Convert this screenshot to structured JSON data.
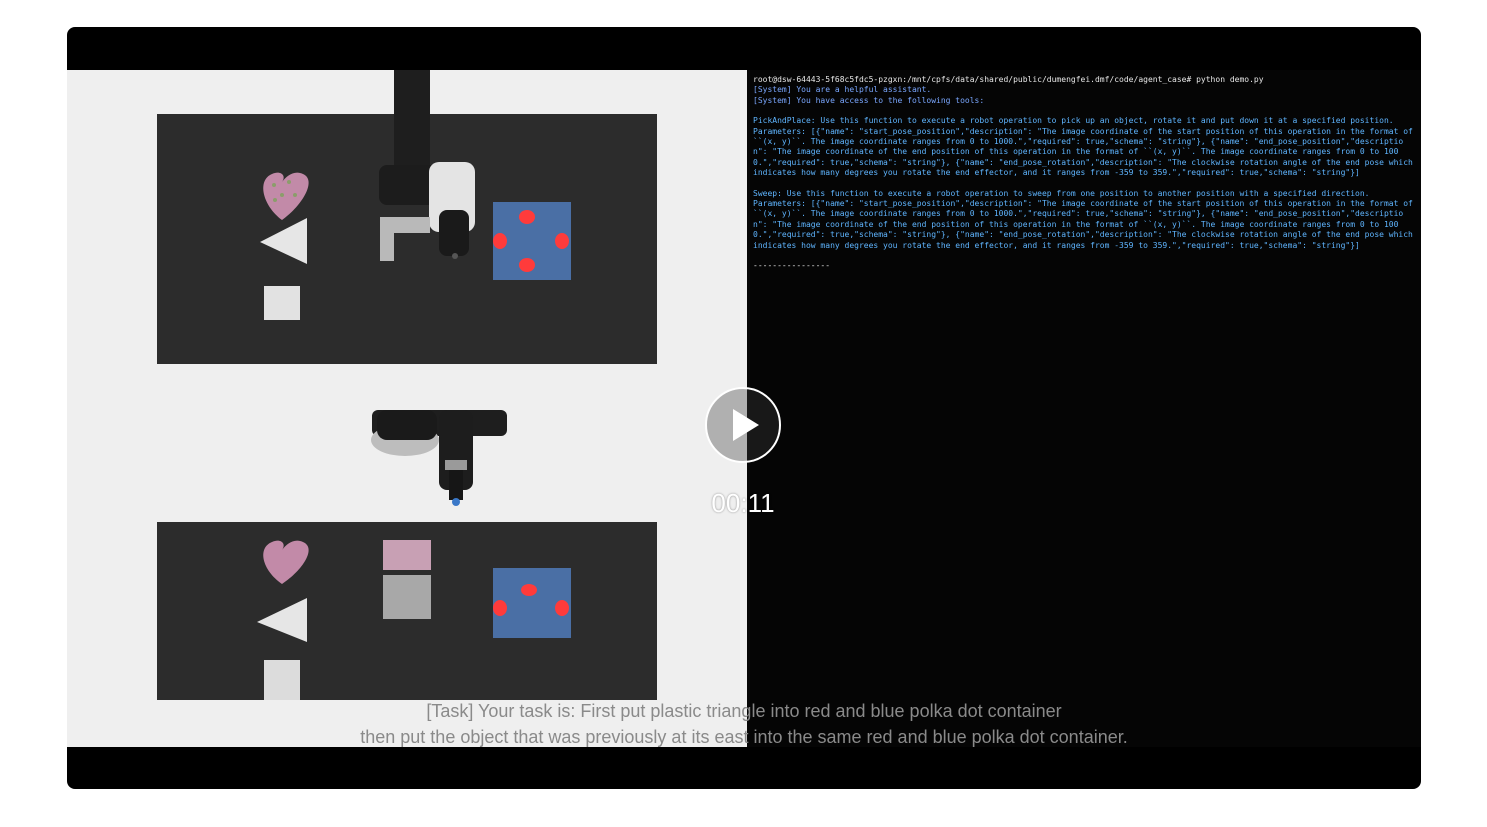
{
  "player": {
    "time": "00:11"
  },
  "terminal": {
    "lines": [
      {
        "text": "root@dsw-64443-5f68c5fdc5-pzgxn:/mnt/cpfs/data/shared/public/dumengfei.dmf/code/agent_case# python demo.py",
        "kind": "cmd"
      },
      {
        "text": "[System] You are a helpful assistant.",
        "kind": "sys"
      },
      {
        "text": "[System] You have access to the following tools:",
        "kind": "sys"
      },
      {
        "text": "",
        "kind": "blank"
      },
      {
        "text": "PickAndPlace: Use this function to execute a robot operation to pick up an object, rotate it and put down it at a specified position.",
        "kind": "tool"
      },
      {
        "text": "Parameters: [{\"name\": \"start_pose_position\",\"description\": \"The image coordinate of the start position of this operation in the format of ``(x, y)``. The image coordinate ranges from 0 to 1000.\",\"required\": true,\"schema\": \"string\"}, {\"name\": \"end_pose_position\",\"description\": \"The image coordinate of the end position of this operation in the format of ``(x, y)``. The image coordinate ranges from 0 to 1000.\",\"required\": true,\"schema\": \"string\"}, {\"name\": \"end_pose_rotation\",\"description\": \"The clockwise rotation angle of the end pose which indicates how many degrees you rotate the end effector, and it ranges from -359 to 359.\",\"required\": true,\"schema\": \"string\"}]",
        "kind": "params"
      },
      {
        "text": "",
        "kind": "blank"
      },
      {
        "text": "Sweep: Use this function to execute a robot operation to sweep from one position to another position with a specified direction.",
        "kind": "tool"
      },
      {
        "text": "Parameters: [{\"name\": \"start_pose_position\",\"description\": \"The image coordinate of the start position of this operation in the format of ``(x, y)``. The image coordinate ranges from 0 to 1000.\",\"required\": true,\"schema\": \"string\"}, {\"name\": \"end_pose_position\",\"description\": \"The image coordinate of the end position of this operation in the format of ``(x, y)``. The image coordinate ranges from 0 to 1000.\",\"required\": true,\"schema\": \"string\"}, {\"name\": \"end_pose_rotation\",\"description\": \"The clockwise rotation angle of the end pose which indicates how many degrees you rotate the end effector, and it ranges from -359 to 359.\",\"required\": true,\"schema\": \"string\"}]",
        "kind": "params"
      },
      {
        "text": "",
        "kind": "blank"
      },
      {
        "text": "----------------",
        "kind": "sep"
      }
    ]
  },
  "subtitles": {
    "line1": "[Task] Your task is: First put plastic triangle into red and blue polka dot container",
    "line2": "then put the object that was previously at its east into the same red and blue polka dot container."
  },
  "colors": {
    "table": "#2c2c2c",
    "sim_background": "#efefef",
    "container_blue": "#4a6fa5",
    "polka_red": "#ff3b3b",
    "heart_pink": "#c28aa8"
  }
}
